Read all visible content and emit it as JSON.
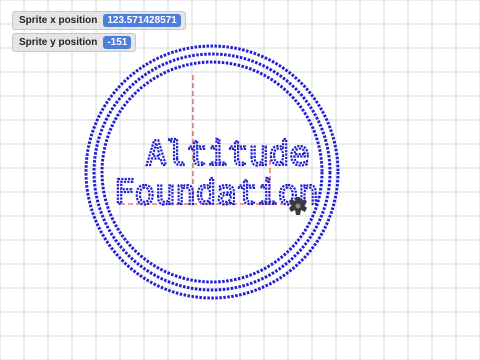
{
  "stage": {
    "background": "#ffffff",
    "grid_color": "#d9d9d9",
    "pen_color": "#1f1fd1",
    "guide_color": "#e03030"
  },
  "monitors": {
    "x_label": "Sprite x position",
    "x_value": "123.571428571",
    "y_label": "Sprite y position",
    "y_value": "-151",
    "value_color": "#4c7fdc"
  },
  "drawing": {
    "line1": "Altitude",
    "line2": "Foundation",
    "ring_count": 3
  },
  "sprite": {
    "icon": "gear-icon"
  }
}
